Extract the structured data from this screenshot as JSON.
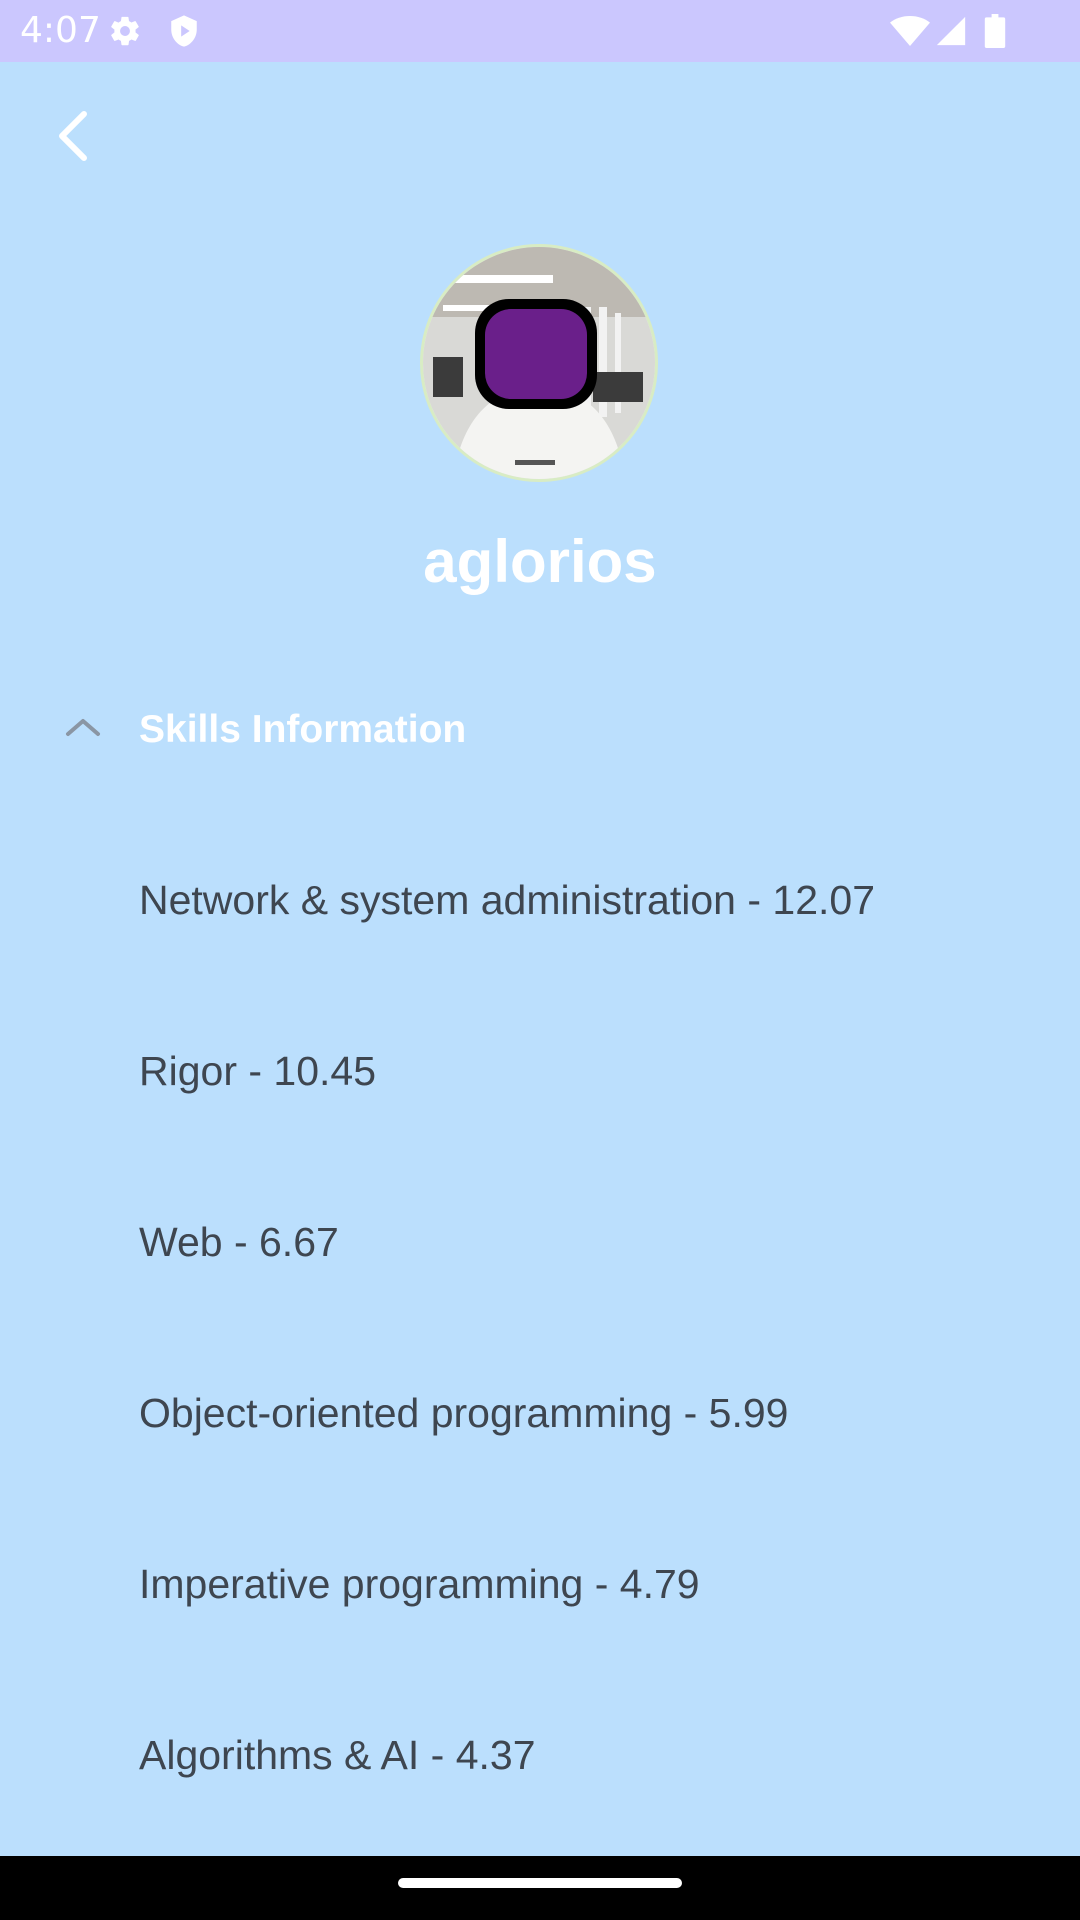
{
  "status_bar": {
    "time": "4:07",
    "left_icons": [
      "gear-icon",
      "shield-icon"
    ],
    "right_icons": [
      "wifi-icon",
      "signal-icon",
      "battery-icon"
    ],
    "background": "#CBC7FE"
  },
  "header": {
    "back_icon": "chevron-left-icon"
  },
  "profile": {
    "username": "aglorios",
    "avatar": "profile-photo"
  },
  "skills_section": {
    "title": "Skills Information",
    "expanded": true,
    "toggle_icon": "chevron-up-icon",
    "items": [
      {
        "label": "Network & system administration - 12.07"
      },
      {
        "label": "Rigor - 10.45"
      },
      {
        "label": "Web - 6.67"
      },
      {
        "label": "Object-oriented programming - 5.99"
      },
      {
        "label": "Imperative programming - 4.79"
      },
      {
        "label": "Algorithms & AI - 4.37"
      }
    ]
  },
  "colors": {
    "background": "#BBDFFD",
    "title_text": "#FFFFFF",
    "item_text": "#3E4650",
    "nav_bar": "#000000"
  }
}
